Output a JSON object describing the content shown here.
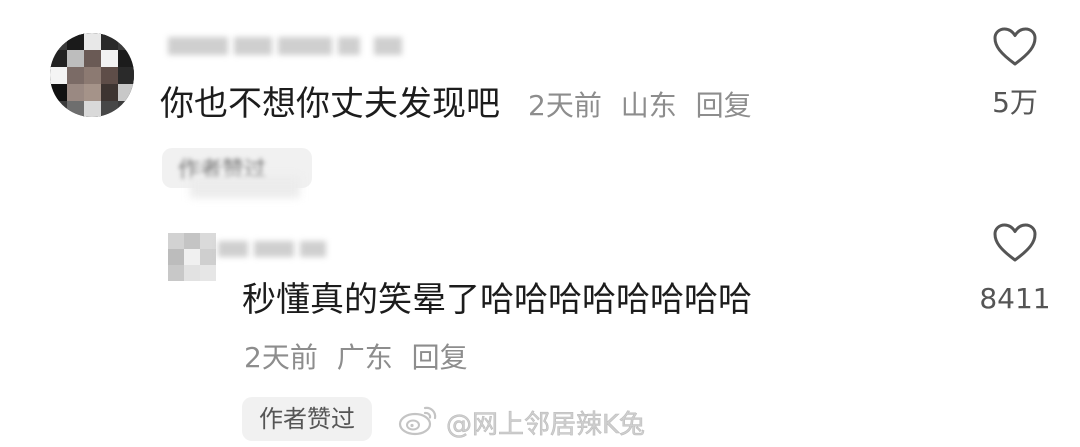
{
  "comments": [
    {
      "text": "你也不想你丈夫发现吧",
      "time": "2天前",
      "location": "山东",
      "reply_label": "回复",
      "like_count": "5万",
      "author_liked": "作者赞过"
    },
    {
      "text": "秒懂真的笑晕了哈哈哈哈哈哈哈哈",
      "time": "2天前",
      "location": "广东",
      "reply_label": "回复",
      "like_count": "8411",
      "author_liked": "作者赞过"
    }
  ],
  "watermark": {
    "text": "@网上邻居辣K兔",
    "icon": "weibo-logo-icon"
  },
  "icons": {
    "like": "heart-outline-icon"
  },
  "colors": {
    "text_primary": "#1c1c1c",
    "text_meta": "#8d8d8d",
    "badge_bg": "#f1f1f1",
    "watermark": "#cfcfcf"
  }
}
